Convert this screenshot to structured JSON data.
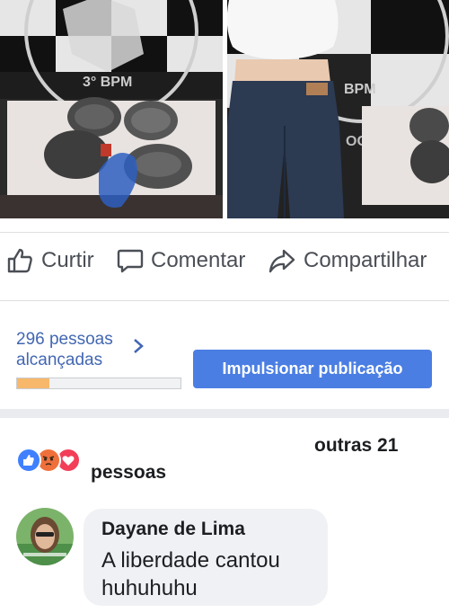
{
  "post_photos": {
    "left_wall_text": "3° BPM",
    "right_wall_text": "BPM",
    "right_wall_text_fragment": "OC"
  },
  "actions": {
    "like_label": "Curtir",
    "comment_label": "Comentar",
    "share_label": "Compartilhar"
  },
  "insights": {
    "reach_line1": "296 pessoas",
    "reach_line2": "alcançadas",
    "reach_progress": 0.2,
    "boost_label": "Impulsionar publicação"
  },
  "reactions": {
    "icons": [
      "like-icon",
      "angry-icon",
      "love-icon"
    ],
    "others_line1": "outras 21",
    "others_line2": "pessoas"
  },
  "comment": {
    "author": "Dayane de Lima",
    "text": "A liberdade cantou huhuhuhu"
  },
  "colors": {
    "accent": "#4267b2",
    "boost_button": "#4a7ee3",
    "progress_fill": "#f7b86b",
    "like_blue": "#4080ff",
    "angry_orange": "#f0703c",
    "love_red": "#f33e58"
  }
}
